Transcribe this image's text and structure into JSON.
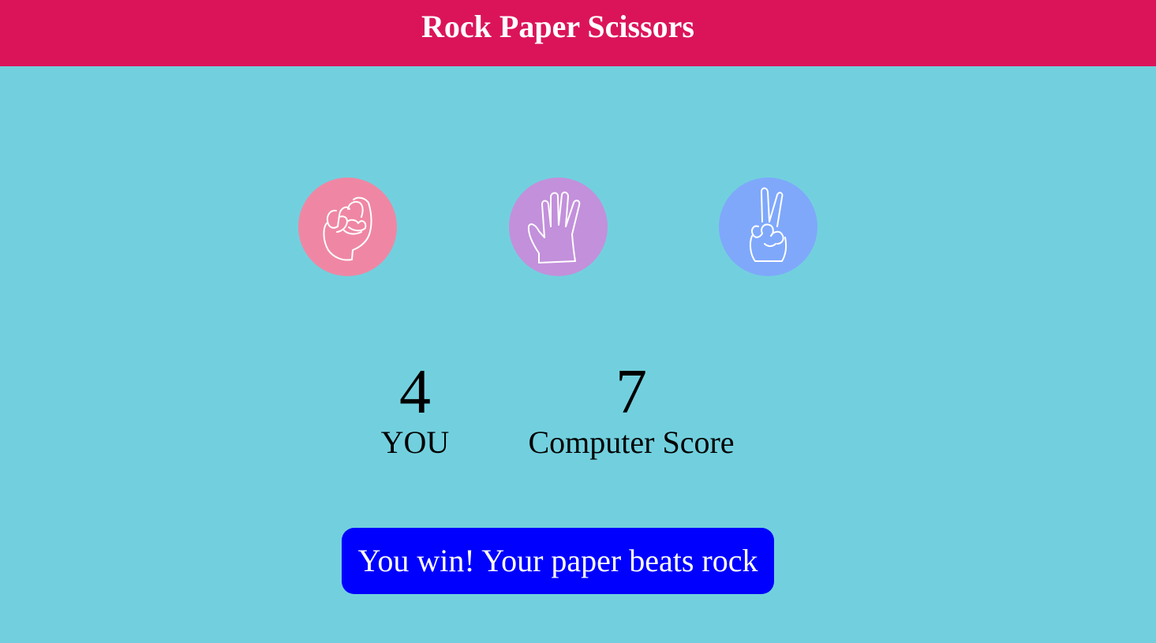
{
  "header": {
    "title": "Rock Paper Scissors",
    "background_color": "#db145a"
  },
  "background_color": "#72d0de",
  "choices": [
    {
      "id": "rock",
      "icon": "rock-fist-icon",
      "color": "#ef87a4"
    },
    {
      "id": "paper",
      "icon": "open-hand-icon",
      "color": "#c390db"
    },
    {
      "id": "scissors",
      "icon": "peace-sign-hand-icon",
      "color": "#7fa8fb"
    }
  ],
  "scores": {
    "user": {
      "value": "4",
      "label": "YOU"
    },
    "computer": {
      "value": "7",
      "label": "Computer Score"
    }
  },
  "result": {
    "message": "You win! Your paper beats rock",
    "background_color": "#0000ff"
  }
}
